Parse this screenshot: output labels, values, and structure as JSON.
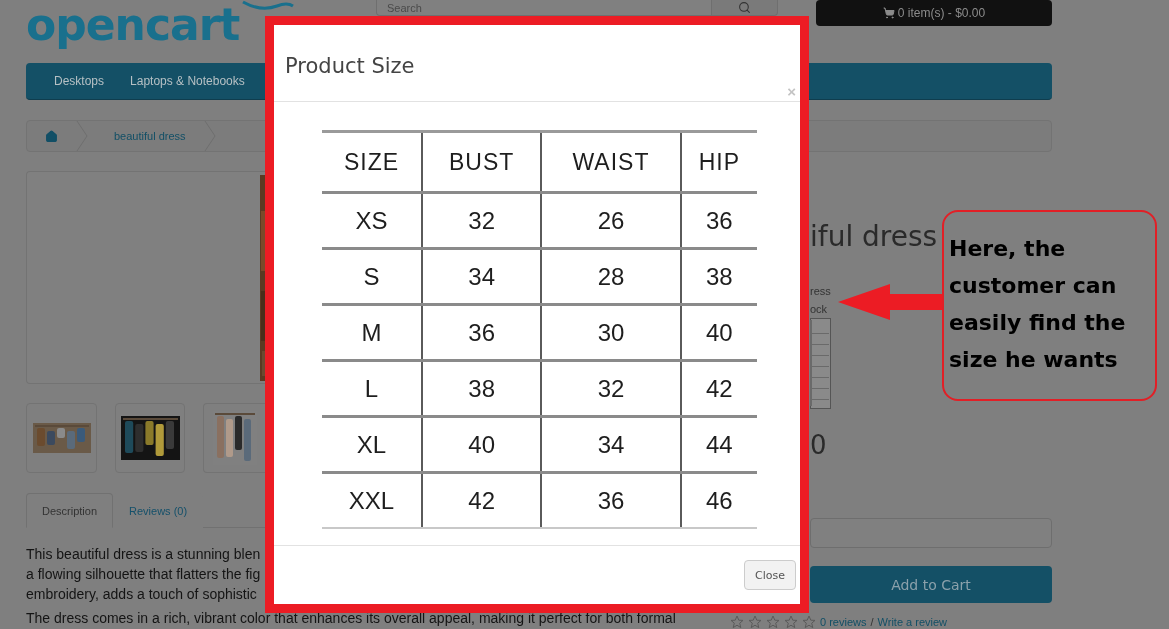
{
  "header": {
    "logo": "opencart",
    "search": {
      "placeholder": "Search"
    },
    "cart": "0 item(s) - $0.00"
  },
  "menu": [
    {
      "label": "Desktops"
    },
    {
      "label": "Laptops & Notebooks"
    }
  ],
  "breadcrumb": [
    {
      "kind": "home"
    },
    {
      "kind": "link",
      "label": "beautiful dress"
    }
  ],
  "tabs": [
    {
      "label": "Description",
      "selected": true
    },
    {
      "label": "Reviews (0)",
      "selected": false
    }
  ],
  "description": [
    "This beautiful dress is a stunning blen",
    "a flowing silhouette that flatters the fig",
    "embroidery, adds a touch of sophistic",
    "The dress comes in a rich, vibrant color that enhances its overall appeal, making it perfect for both formal"
  ],
  "product": {
    "title": "iful dress",
    "details": [
      "ress",
      "ock"
    ],
    "price": "0",
    "add_to_cart": "Add to Cart",
    "stars": 0,
    "reviews": "0 reviews",
    "separator": "/",
    "write_review": "Write a review"
  },
  "modal": {
    "title": "Product Size",
    "dismiss": "×",
    "size_chart": {
      "columns": [
        "SIZE",
        "BUST",
        "WAIST",
        "HIP"
      ],
      "rows": [
        [
          "XS",
          "32",
          "26",
          "36"
        ],
        [
          "S",
          "34",
          "28",
          "38"
        ],
        [
          "M",
          "36",
          "30",
          "40"
        ],
        [
          "L",
          "38",
          "32",
          "42"
        ],
        [
          "XL",
          "40",
          "34",
          "44"
        ],
        [
          "XXL",
          "42",
          "36",
          "46"
        ]
      ]
    },
    "close_button": "Close"
  },
  "callout": {
    "text": "Here, the customer can easily find the size he wants"
  }
}
